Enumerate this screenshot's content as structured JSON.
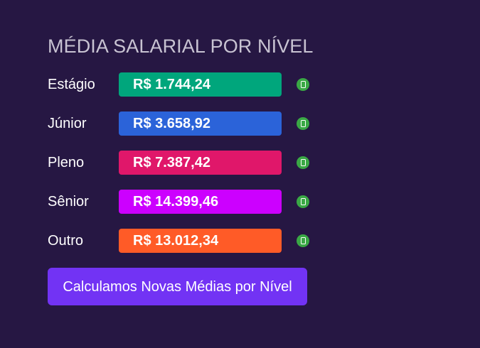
{
  "page": {
    "title": "MÉDIA SALARIAL POR NÍVEL"
  },
  "levels": [
    {
      "label": "Estágio",
      "value": "R$ 1.744,24",
      "color": "#00a67c"
    },
    {
      "label": "Júnior",
      "value": "R$ 3.658,92",
      "color": "#2b63d9"
    },
    {
      "label": "Pleno",
      "value": "R$ 7.387,42",
      "color": "#e0176a"
    },
    {
      "label": "Sênior",
      "value": "R$ 14.399,46",
      "color": "#cc00ff"
    },
    {
      "label": "Outro",
      "value": "R$ 13.012,34",
      "color": "#ff5b27"
    }
  ],
  "status_icon": {
    "icon": "copy-icon",
    "color": "#3aa845"
  },
  "action": {
    "label": "Calculamos Novas Médias por Nível",
    "color": "#7233f4"
  },
  "theme": {
    "background": "#261743",
    "title_color": "#c8c3d2"
  }
}
